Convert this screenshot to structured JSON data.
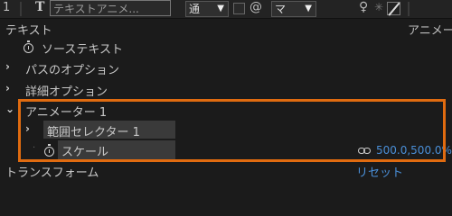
{
  "topbar": {
    "index": "1",
    "layer_name": "テキストアニメ...",
    "mode": "通",
    "track_matte": "マ"
  },
  "header": {
    "section_label": "テキスト",
    "right_label": "アニメー"
  },
  "properties": {
    "source_text": "ソーステキスト",
    "path_options": "パスのオプション",
    "more_options": "詳細オプション",
    "animator": "アニメーター 1",
    "range_selector": "範囲セレクター 1",
    "scale_label": "スケール",
    "scale_value": "500.0,500.0%",
    "transform": "トランスフォーム",
    "reset": "リセット"
  }
}
